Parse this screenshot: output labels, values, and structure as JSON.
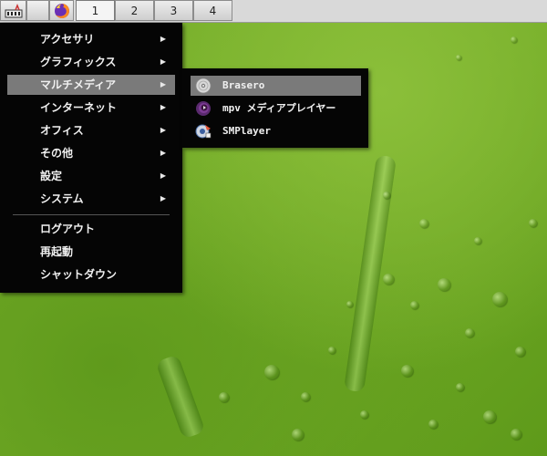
{
  "taskbar": {
    "launchers": [
      {
        "name": "system-monitor-icon"
      },
      {
        "name": "blank-launcher"
      },
      {
        "name": "firefox-icon"
      }
    ],
    "workspaces": [
      "1",
      "2",
      "3",
      "4"
    ],
    "active_workspace": "1"
  },
  "main_menu": {
    "items": [
      {
        "label": "アクセサリ",
        "submenu": true
      },
      {
        "label": "グラフィックス",
        "submenu": true
      },
      {
        "label": "マルチメディア",
        "submenu": true,
        "selected": true
      },
      {
        "label": "インターネット",
        "submenu": true
      },
      {
        "label": "オフィス",
        "submenu": true
      },
      {
        "label": "その他",
        "submenu": true
      },
      {
        "label": "設定",
        "submenu": true
      },
      {
        "label": "システム",
        "submenu": true
      }
    ],
    "actions": [
      {
        "label": "ログアウト"
      },
      {
        "label": "再起動"
      },
      {
        "label": "シャットダウン"
      }
    ],
    "arrow_glyph": "▶"
  },
  "sub_menu": {
    "items": [
      {
        "label": "Brasero",
        "icon": "brasero-disc-icon",
        "selected": true
      },
      {
        "label": "mpv メディアプレイヤー",
        "icon": "mpv-icon"
      },
      {
        "label": "SMPlayer",
        "icon": "smplayer-icon"
      }
    ]
  },
  "colors": {
    "menu_bg": "#050505",
    "menu_selected": "#7a7a7a",
    "desktop_green": "#6ea826"
  }
}
